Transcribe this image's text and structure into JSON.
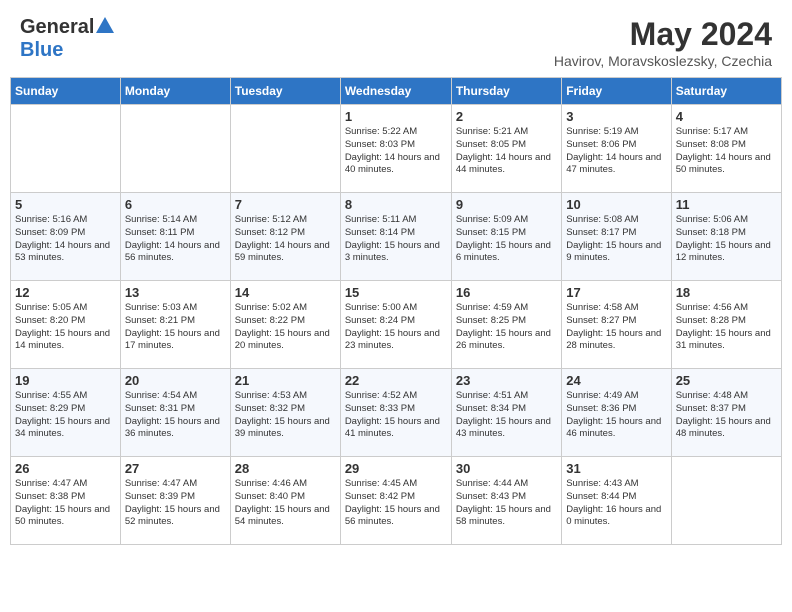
{
  "header": {
    "logo_general": "General",
    "logo_blue": "Blue",
    "month_year": "May 2024",
    "location": "Havirov, Moravskoslezsky, Czechia"
  },
  "days_of_week": [
    "Sunday",
    "Monday",
    "Tuesday",
    "Wednesday",
    "Thursday",
    "Friday",
    "Saturday"
  ],
  "weeks": [
    [
      {
        "day": "",
        "info": ""
      },
      {
        "day": "",
        "info": ""
      },
      {
        "day": "",
        "info": ""
      },
      {
        "day": "1",
        "info": "Sunrise: 5:22 AM\nSunset: 8:03 PM\nDaylight: 14 hours and 40 minutes."
      },
      {
        "day": "2",
        "info": "Sunrise: 5:21 AM\nSunset: 8:05 PM\nDaylight: 14 hours and 44 minutes."
      },
      {
        "day": "3",
        "info": "Sunrise: 5:19 AM\nSunset: 8:06 PM\nDaylight: 14 hours and 47 minutes."
      },
      {
        "day": "4",
        "info": "Sunrise: 5:17 AM\nSunset: 8:08 PM\nDaylight: 14 hours and 50 minutes."
      }
    ],
    [
      {
        "day": "5",
        "info": "Sunrise: 5:16 AM\nSunset: 8:09 PM\nDaylight: 14 hours and 53 minutes."
      },
      {
        "day": "6",
        "info": "Sunrise: 5:14 AM\nSunset: 8:11 PM\nDaylight: 14 hours and 56 minutes."
      },
      {
        "day": "7",
        "info": "Sunrise: 5:12 AM\nSunset: 8:12 PM\nDaylight: 14 hours and 59 minutes."
      },
      {
        "day": "8",
        "info": "Sunrise: 5:11 AM\nSunset: 8:14 PM\nDaylight: 15 hours and 3 minutes."
      },
      {
        "day": "9",
        "info": "Sunrise: 5:09 AM\nSunset: 8:15 PM\nDaylight: 15 hours and 6 minutes."
      },
      {
        "day": "10",
        "info": "Sunrise: 5:08 AM\nSunset: 8:17 PM\nDaylight: 15 hours and 9 minutes."
      },
      {
        "day": "11",
        "info": "Sunrise: 5:06 AM\nSunset: 8:18 PM\nDaylight: 15 hours and 12 minutes."
      }
    ],
    [
      {
        "day": "12",
        "info": "Sunrise: 5:05 AM\nSunset: 8:20 PM\nDaylight: 15 hours and 14 minutes."
      },
      {
        "day": "13",
        "info": "Sunrise: 5:03 AM\nSunset: 8:21 PM\nDaylight: 15 hours and 17 minutes."
      },
      {
        "day": "14",
        "info": "Sunrise: 5:02 AM\nSunset: 8:22 PM\nDaylight: 15 hours and 20 minutes."
      },
      {
        "day": "15",
        "info": "Sunrise: 5:00 AM\nSunset: 8:24 PM\nDaylight: 15 hours and 23 minutes."
      },
      {
        "day": "16",
        "info": "Sunrise: 4:59 AM\nSunset: 8:25 PM\nDaylight: 15 hours and 26 minutes."
      },
      {
        "day": "17",
        "info": "Sunrise: 4:58 AM\nSunset: 8:27 PM\nDaylight: 15 hours and 28 minutes."
      },
      {
        "day": "18",
        "info": "Sunrise: 4:56 AM\nSunset: 8:28 PM\nDaylight: 15 hours and 31 minutes."
      }
    ],
    [
      {
        "day": "19",
        "info": "Sunrise: 4:55 AM\nSunset: 8:29 PM\nDaylight: 15 hours and 34 minutes."
      },
      {
        "day": "20",
        "info": "Sunrise: 4:54 AM\nSunset: 8:31 PM\nDaylight: 15 hours and 36 minutes."
      },
      {
        "day": "21",
        "info": "Sunrise: 4:53 AM\nSunset: 8:32 PM\nDaylight: 15 hours and 39 minutes."
      },
      {
        "day": "22",
        "info": "Sunrise: 4:52 AM\nSunset: 8:33 PM\nDaylight: 15 hours and 41 minutes."
      },
      {
        "day": "23",
        "info": "Sunrise: 4:51 AM\nSunset: 8:34 PM\nDaylight: 15 hours and 43 minutes."
      },
      {
        "day": "24",
        "info": "Sunrise: 4:49 AM\nSunset: 8:36 PM\nDaylight: 15 hours and 46 minutes."
      },
      {
        "day": "25",
        "info": "Sunrise: 4:48 AM\nSunset: 8:37 PM\nDaylight: 15 hours and 48 minutes."
      }
    ],
    [
      {
        "day": "26",
        "info": "Sunrise: 4:47 AM\nSunset: 8:38 PM\nDaylight: 15 hours and 50 minutes."
      },
      {
        "day": "27",
        "info": "Sunrise: 4:47 AM\nSunset: 8:39 PM\nDaylight: 15 hours and 52 minutes."
      },
      {
        "day": "28",
        "info": "Sunrise: 4:46 AM\nSunset: 8:40 PM\nDaylight: 15 hours and 54 minutes."
      },
      {
        "day": "29",
        "info": "Sunrise: 4:45 AM\nSunset: 8:42 PM\nDaylight: 15 hours and 56 minutes."
      },
      {
        "day": "30",
        "info": "Sunrise: 4:44 AM\nSunset: 8:43 PM\nDaylight: 15 hours and 58 minutes."
      },
      {
        "day": "31",
        "info": "Sunrise: 4:43 AM\nSunset: 8:44 PM\nDaylight: 16 hours and 0 minutes."
      },
      {
        "day": "",
        "info": ""
      }
    ]
  ]
}
